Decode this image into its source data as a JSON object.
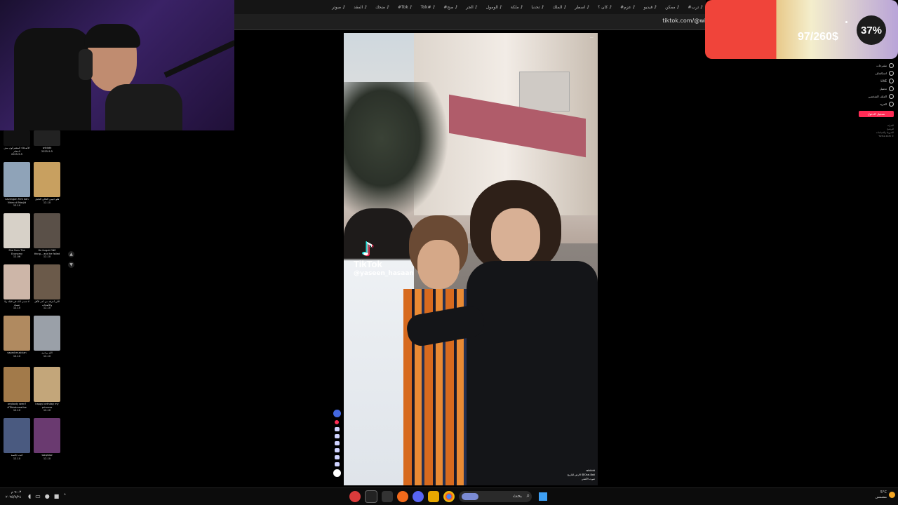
{
  "browser": {
    "tabs": [
      "#ترب",
      "ممكن",
      "فيديو",
      "#عزم",
      "كان ؟",
      "اسطر",
      "الملك",
      "تحديا",
      "ملكة",
      "الومول",
      "الجر",
      "#صح",
      "Tok#",
      "#Tok",
      "ضحك",
      "المقد",
      "صوتر"
    ],
    "url": "tiktok.com/@wi"
  },
  "donation_goal": {
    "amount": "97/260$",
    "percent_label": "37%",
    "progress": 0.37
  },
  "right_nav": {
    "items": [
      "مقترحات",
      "استكشاف",
      "LIVE",
      "تحميل",
      "الملف الشخصي",
      "المزيد"
    ],
    "login_button": "تسجيل الدخول",
    "footer_lines": [
      "الشركة",
      "البرنامج",
      "الشروط والسياسات",
      "TikTok 2025 ©"
    ]
  },
  "feed": {
    "cards": [
      {
        "caption": "الأصدقاء المشتركون مش المعلم",
        "meta": "2025-9-5"
      },
      {
        "caption": "wikibkt",
        "meta": "2025-9-5"
      },
      {
        "caption": "Lavangan Fem dan Video di Masjid",
        "meta": "12-10"
      },
      {
        "caption": "هلو حبيبي الغالي الجليل",
        "meta": "12-10"
      },
      {
        "caption": "She Fans The Economy",
        "meta": "12-06"
      },
      {
        "caption": "He forgot ONE thing... and he failed",
        "meta": "12-10"
      },
      {
        "caption": "لا تنسى الله في قلبك ولا تنساه",
        "meta": "12-10"
      },
      {
        "caption": "اللي أعرفه من أعز الأهل والأصحاب",
        "meta": "12-10"
      },
      {
        "caption": "sayad.musician",
        "meta": "12-10"
      },
      {
        "caption": "الله يرحمه",
        "meta": "12-10"
      },
      {
        "caption": "anybody seen? #Tiktokcreative",
        "meta": "12-10"
      },
      {
        "caption": "happy birthday my princess",
        "meta": "12-10"
      },
      {
        "caption": "كنت جالسة",
        "meta": "12-10"
      },
      {
        "caption": "waqalaw",
        "meta": "12-10"
      }
    ]
  },
  "video": {
    "brand": "TikTok",
    "username": "@yaseen_hasaan",
    "caption_lines": [
      "wikibkt",
      "الارض للتاريخ @Chai.Bali",
      "صوت الأصلي"
    ]
  },
  "taskbar": {
    "time": "٩:٠٣ م",
    "date": "٢٠٢٥/٧/٢٤",
    "search_placeholder": "بحث",
    "weather_temp": "5°C",
    "weather_desc": "مشمس"
  },
  "colors": {
    "goal_red": "#f0443a",
    "tiktok_pink": "#fe2c55",
    "tiktok_cyan": "#25f4ee"
  }
}
